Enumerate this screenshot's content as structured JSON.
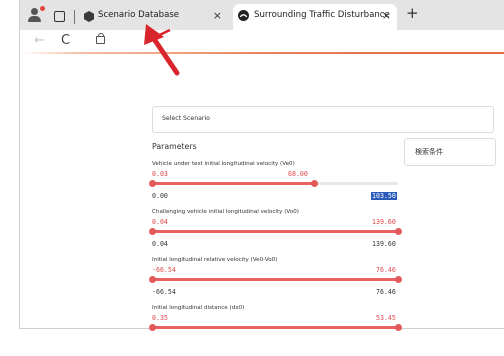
{
  "browser": {
    "tabs": [
      {
        "title": "Scenario Database",
        "close": "×"
      },
      {
        "title": "Surrounding Traffic Disturbance",
        "close": "×"
      }
    ],
    "new_tab": "+"
  },
  "toolbar": {
    "back": "←",
    "reload": "C"
  },
  "page": {
    "select_placeholder": "Select Scenario",
    "side_input": "検索条件",
    "section_title": "Parameters",
    "params": [
      {
        "label": "Vehicle under test initial longitudinal velocity (Ve0)",
        "range_min": "0.03",
        "range_max": "68.00",
        "input_min": "0.00",
        "input_max": "103.50",
        "low": 0.0,
        "high": 0.657
      },
      {
        "label": "Challenging vehicle initial longitudinal velocity (Vo0)",
        "range_min": "0.04",
        "range_max": "139.60",
        "input_min": "0.04",
        "input_max": "139.60",
        "low": 0.0,
        "high": 1.0
      },
      {
        "label": "Initial longitudinal relative velocity (Ve0-Vo0)",
        "range_min": "-66.54",
        "range_max": "76.46",
        "input_min": "-66.54",
        "input_max": "76.46",
        "low": 0.0,
        "high": 1.0
      },
      {
        "label": "Initial longitudinal distance (dx0)",
        "range_min": "0.35",
        "range_max": "53.45",
        "low": 0.0,
        "high": 1.0
      }
    ]
  },
  "colors": {
    "accent": "#e56a3f",
    "slider": "#e35a5a",
    "arrow": "#d9262c",
    "highlight": "#2a5bb8"
  }
}
